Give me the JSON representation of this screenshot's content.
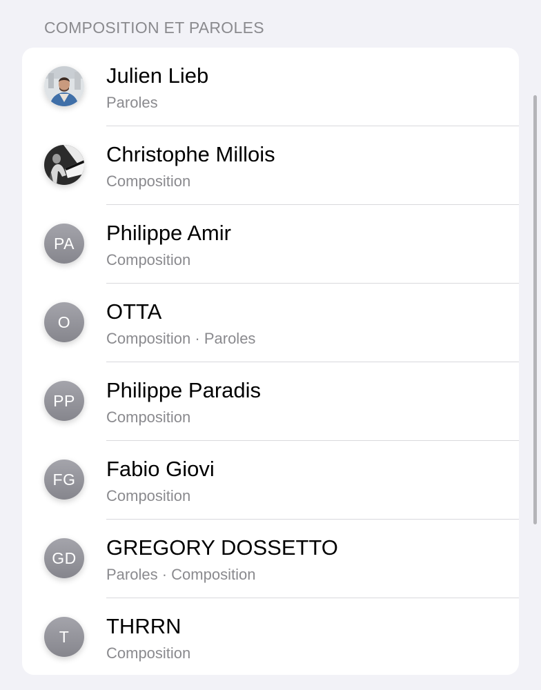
{
  "section": {
    "title": "COMPOSITION ET PAROLES"
  },
  "credits": [
    {
      "name": "Julien Lieb",
      "role": "Paroles",
      "avatar": {
        "type": "photo",
        "icon": "person-photo"
      }
    },
    {
      "name": "Christophe Millois",
      "role": "Composition",
      "avatar": {
        "type": "photo",
        "icon": "pianist-photo"
      }
    },
    {
      "name": "Philippe Amir",
      "role": "Composition",
      "avatar": {
        "type": "initials",
        "initials": "PA"
      }
    },
    {
      "name": "OTTA",
      "role": "Composition · Paroles",
      "avatar": {
        "type": "initials",
        "initials": "O"
      }
    },
    {
      "name": "Philippe Paradis",
      "role": "Composition",
      "avatar": {
        "type": "initials",
        "initials": "PP"
      }
    },
    {
      "name": "Fabio Giovi",
      "role": "Composition",
      "avatar": {
        "type": "initials",
        "initials": "FG"
      }
    },
    {
      "name": "GREGORY DOSSETTO",
      "role": "Paroles · Composition",
      "avatar": {
        "type": "initials",
        "initials": "GD"
      }
    },
    {
      "name": "THRRN",
      "role": "Composition",
      "avatar": {
        "type": "initials",
        "initials": "T"
      }
    }
  ],
  "colors": {
    "background": "#f2f2f7",
    "card": "#ffffff",
    "secondary_text": "#8a8a8e",
    "avatar_gray": "#98989f"
  }
}
